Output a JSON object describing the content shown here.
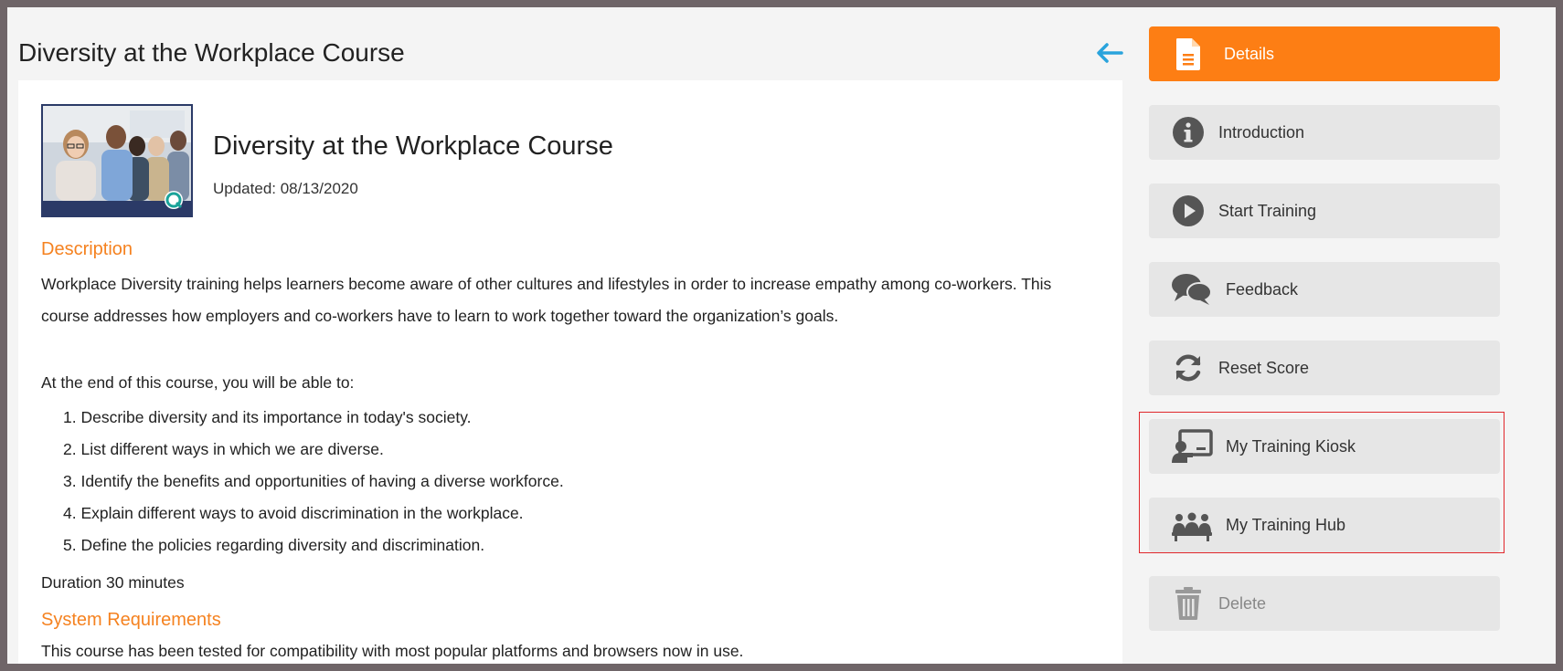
{
  "page": {
    "title": "Diversity at the Workplace Course"
  },
  "course": {
    "thumbnail_alt": "Group of diverse coworkers smiling",
    "title": "Diversity at the Workplace Course",
    "updated": "Updated: 08/13/2020",
    "description_heading": "Description",
    "description_lines": [
      "Workplace Diversity training helps learners become aware of other cultures and lifestyles in order to increase empathy among co-workers. This",
      "course addresses how employers and co-workers have to learn to work together toward the organization’s goals."
    ],
    "objectives_intro": "At the end of this course, you will be able to:",
    "objectives": [
      "1. Describe diversity and its importance in today's society.",
      "2. List different ways in which we are diverse.",
      "3. Identify the benefits and opportunities of having a diverse workforce.",
      "4. Explain different ways to avoid discrimination in the workplace.",
      "5. Define the policies regarding diversity and discrimination."
    ],
    "duration": "Duration 30 minutes",
    "sysreq_heading": "System Requirements",
    "sysreq_text": "This course has been tested for compatibility with most popular platforms and browsers now in use."
  },
  "sidebar": {
    "items": [
      {
        "label": "Details",
        "icon": "document-icon"
      },
      {
        "label": "Introduction",
        "icon": "info-icon"
      },
      {
        "label": "Start Training",
        "icon": "play-icon"
      },
      {
        "label": "Feedback",
        "icon": "chat-icon"
      },
      {
        "label": "Reset Score",
        "icon": "refresh-icon"
      },
      {
        "label": "My Training Kiosk",
        "icon": "presentation-icon"
      },
      {
        "label": "My Training Hub",
        "icon": "group-icon"
      },
      {
        "label": "Delete",
        "icon": "trash-icon"
      }
    ]
  },
  "colors": {
    "accent": "#fd7e14",
    "heading_orange": "#f58220",
    "back_arrow": "#29a3dc",
    "highlight_border": "#e0272b",
    "button_bg": "#e6e6e6",
    "icon_gray": "#555555"
  }
}
